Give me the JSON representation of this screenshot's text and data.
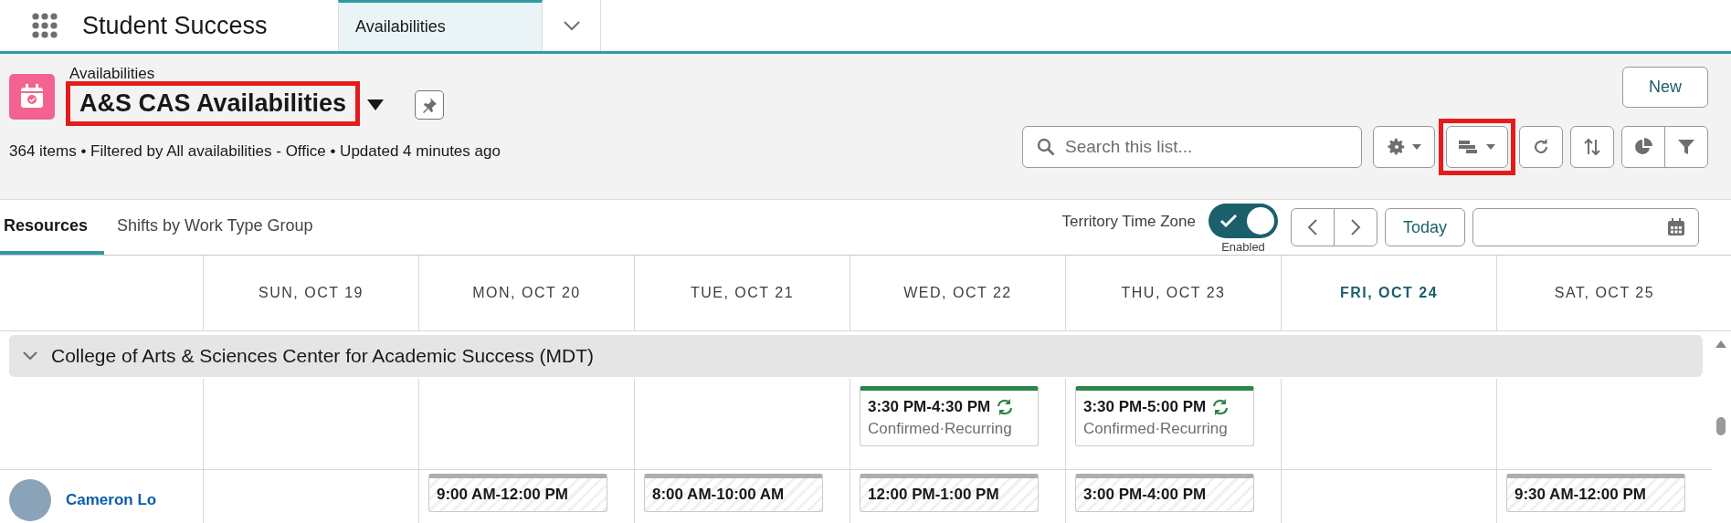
{
  "app": {
    "name": "Student Success",
    "tabs": [
      {
        "label": "Availabilities",
        "selected": true
      }
    ]
  },
  "header": {
    "object_label": "Availabilities",
    "title": {
      "text": "A&S CAS Availabilities",
      "highlighted": true
    },
    "summary": "364 items • Filtered by All availabilities - Office • Updated 4 minutes ago",
    "new_button": "New",
    "search": {
      "placeholder": "Search this list..."
    },
    "toolbar": [
      {
        "kind": "settings",
        "highlighted": false
      },
      {
        "kind": "display",
        "highlighted": true
      },
      {
        "kind": "refresh",
        "highlighted": false
      },
      {
        "kind": "sort",
        "highlighted": false
      },
      {
        "kind": "chart",
        "highlighted": false
      },
      {
        "kind": "filter",
        "highlighted": false
      }
    ]
  },
  "view_tabs": [
    {
      "label": "Resources",
      "selected": true
    },
    {
      "label": "Shifts by Work Type Group",
      "selected": false
    }
  ],
  "time_zone": {
    "label": "Territory Time Zone",
    "on": true,
    "status": "Enabled"
  },
  "today_button": "Today",
  "calendar": {
    "days": [
      {
        "label": "SUN, OCT 19",
        "selected": false
      },
      {
        "label": "MON, OCT 20",
        "selected": false
      },
      {
        "label": "TUE, OCT 21",
        "selected": false
      },
      {
        "label": "WED, OCT 22",
        "selected": false
      },
      {
        "label": "THU, OCT 23",
        "selected": false
      },
      {
        "label": "FRI, OCT 24",
        "selected": true
      },
      {
        "label": "SAT, OCT 25",
        "selected": false
      }
    ],
    "groups": [
      {
        "name": "College of Arts & Sciences Center for Academic Success (MDT)",
        "expanded": true,
        "rows": [
          {
            "cells": [
              null,
              null,
              null,
              {
                "time": "3:30 PM-4:30 PM",
                "detail": "Confirmed·Recurring",
                "color": "#2e844a",
                "recurring": true
              },
              {
                "time": "3:30 PM-5:00 PM",
                "detail": "Confirmed·Recurring",
                "color": "#2e844a",
                "recurring": true
              },
              null,
              null
            ]
          },
          {
            "resource": "Cameron Lo",
            "cells": [
              null,
              {
                "time": "9:00 AM-12:00 PM",
                "color": "#aeaeae",
                "recurring": false
              },
              {
                "time": "8:00 AM-10:00 AM",
                "color": "#aeaeae",
                "recurring": false
              },
              {
                "time": "12:00 PM-1:00 PM",
                "color": "#aeaeae",
                "recurring": false
              },
              {
                "time": "3:00 PM-4:00 PM",
                "color": "#aeaeae",
                "recurring": false
              },
              null,
              {
                "time": "9:30 AM-12:00 PM",
                "color": "#aeaeae",
                "recurring": false
              }
            ]
          }
        ]
      }
    ]
  }
}
